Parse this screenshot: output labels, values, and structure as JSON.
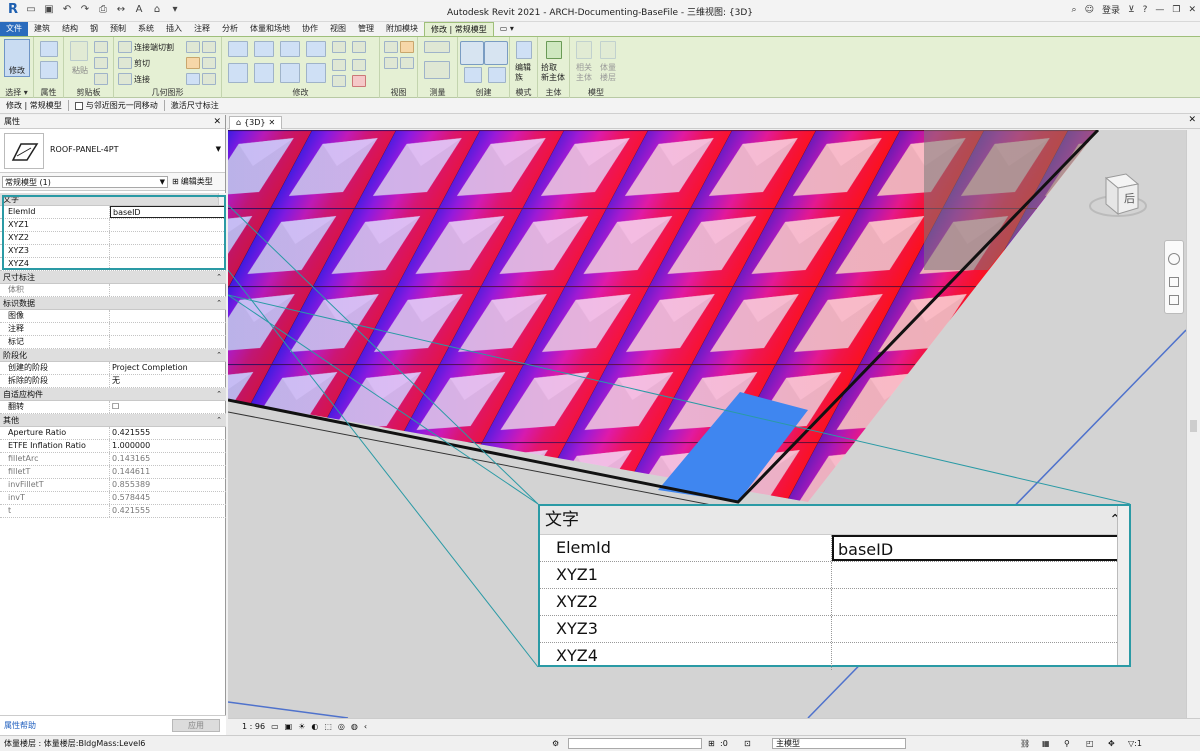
{
  "window": {
    "title": "Autodesk Revit 2021 - ARCH-Documenting-BaseFile - 三维视图: {3D}",
    "login": "登录",
    "help_glyph": "?"
  },
  "menu": {
    "items": [
      "文件",
      "建筑",
      "结构",
      "钢",
      "预制",
      "系统",
      "插入",
      "注释",
      "分析",
      "体量和场地",
      "协作",
      "视图",
      "管理",
      "附加模块",
      "修改 | 常规模型"
    ]
  },
  "ribbon": {
    "modify_label": "修改",
    "groups": [
      "选择",
      "属性",
      "剪贴板",
      "几何图形",
      "修改",
      "视图",
      "测量",
      "创建",
      "模式",
      "主体",
      "模型"
    ],
    "group_labels": {
      "select": "选择 ▾",
      "properties": "属性",
      "clipboard": "剪贴板",
      "geometry": "几何图形",
      "modify": "修改",
      "view": "视图",
      "measure": "测量",
      "create": "创建",
      "mode": "模式",
      "host": "主体",
      "model": "模型"
    },
    "texts": {
      "paste": "粘贴",
      "connect_cut": "连接端切割",
      "cut": "剪切",
      "join": "连接",
      "edit_family": "编辑\n族",
      "pick_host": "拾取\n新主体",
      "related_host": "相关\n主体",
      "mass_floors": "体量\n楼层"
    }
  },
  "options_bar": {
    "context": "修改 | 常规模型",
    "checkbox_label": "与邻近图元一同移动",
    "activate_dims": "激活尺寸标注"
  },
  "properties": {
    "title": "属性",
    "type_name": "ROOF-PANEL-4PT",
    "filter": "常规模型 (1)",
    "edit_type": "编辑类型",
    "sections": [
      {
        "name": "文字",
        "rows": [
          {
            "k": "ElemId",
            "v": "baseID",
            "editing": true
          },
          {
            "k": "XYZ1",
            "v": ""
          },
          {
            "k": "XYZ2",
            "v": ""
          },
          {
            "k": "XYZ3",
            "v": ""
          },
          {
            "k": "XYZ4",
            "v": ""
          }
        ]
      },
      {
        "name": "尺寸标注",
        "rows": [
          {
            "k": "体积",
            "v": "",
            "dim": true
          }
        ]
      },
      {
        "name": "标识数据",
        "rows": [
          {
            "k": "图像",
            "v": ""
          },
          {
            "k": "注释",
            "v": ""
          },
          {
            "k": "标记",
            "v": ""
          }
        ]
      },
      {
        "name": "阶段化",
        "rows": [
          {
            "k": "创建的阶段",
            "v": "Project Completion"
          },
          {
            "k": "拆除的阶段",
            "v": "无"
          }
        ]
      },
      {
        "name": "自适应构件",
        "rows": [
          {
            "k": "翻转",
            "v": "☐"
          }
        ]
      },
      {
        "name": "其他",
        "rows": [
          {
            "k": "Aperture Ratio",
            "v": "0.421555"
          },
          {
            "k": "ETFE Inflation Ratio",
            "v": "1.000000"
          },
          {
            "k": "filletArc",
            "v": "0.143165",
            "dim": true
          },
          {
            "k": "filletT",
            "v": "0.144611",
            "dim": true
          },
          {
            "k": "invFilletT",
            "v": "0.855389",
            "dim": true
          },
          {
            "k": "invT",
            "v": "0.578445",
            "dim": true
          },
          {
            "k": "t",
            "v": "0.421555",
            "dim": true
          }
        ]
      }
    ],
    "help": "属性帮助",
    "apply": "应用"
  },
  "view": {
    "tab": "{3D}",
    "scale": "1 : 96",
    "navcube_face": "后"
  },
  "zoom_callout": {
    "section": "文字",
    "rows": [
      {
        "k": "ElemId",
        "v": "baseID"
      },
      {
        "k": "XYZ1",
        "v": ""
      },
      {
        "k": "XYZ2",
        "v": ""
      },
      {
        "k": "XYZ3",
        "v": ""
      },
      {
        "k": "XYZ4",
        "v": ""
      }
    ]
  },
  "status": {
    "text": "体量楼层 : 体量楼层:BldgMass:Level6",
    "zero": ":0",
    "model": "主模型",
    "filter": "▽:1"
  }
}
